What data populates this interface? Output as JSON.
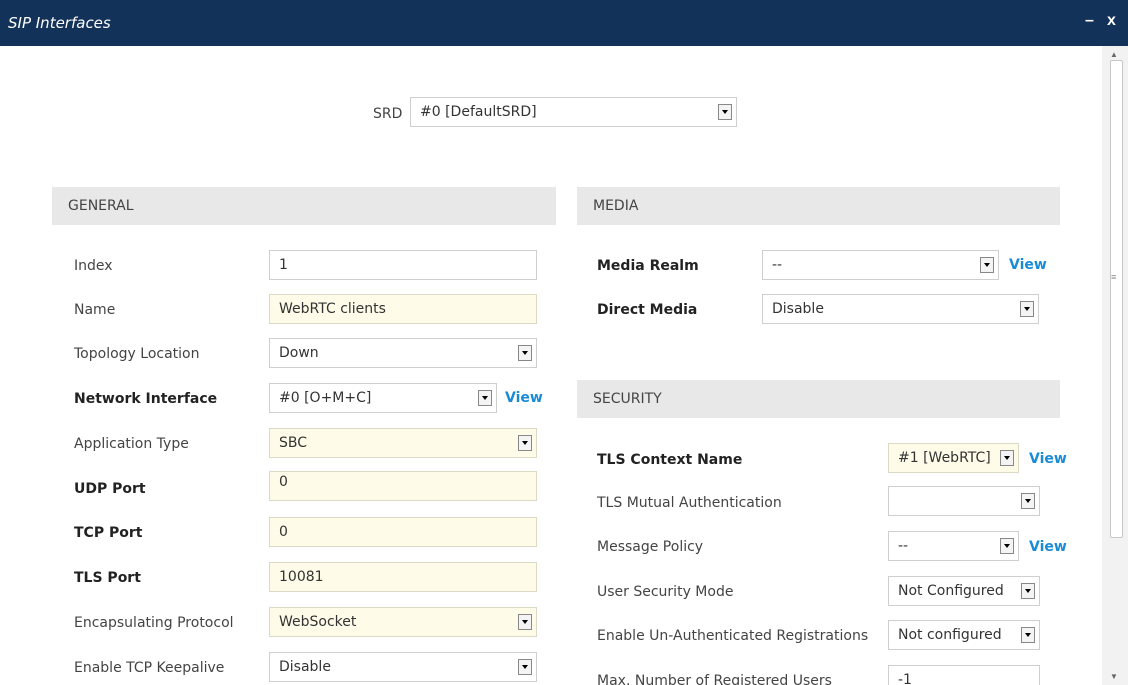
{
  "window": {
    "title": "SIP Interfaces",
    "minimize": "–",
    "close": "x"
  },
  "srd": {
    "label": "SRD",
    "value": "#0 [DefaultSRD]"
  },
  "general": {
    "heading": "GENERAL",
    "fields": {
      "index": {
        "label": "Index",
        "value": "1"
      },
      "name": {
        "label": "Name",
        "value": "WebRTC clients"
      },
      "topology": {
        "label": "Topology Location",
        "value": "Down"
      },
      "network_interface": {
        "label": "Network Interface",
        "value": "#0 [O+M+C]",
        "view": "View"
      },
      "application_type": {
        "label": "Application Type",
        "value": "SBC"
      },
      "udp_port": {
        "label": "UDP Port",
        "value": "0"
      },
      "tcp_port": {
        "label": "TCP Port",
        "value": "0"
      },
      "tls_port": {
        "label": "TLS Port",
        "value": "10081"
      },
      "encapsulating": {
        "label": "Encapsulating Protocol",
        "value": "WebSocket"
      },
      "tcp_keepalive": {
        "label": "Enable TCP Keepalive",
        "value": "Disable"
      }
    }
  },
  "media": {
    "heading": "MEDIA",
    "fields": {
      "media_realm": {
        "label": "Media Realm",
        "value": "--",
        "view": "View"
      },
      "direct_media": {
        "label": "Direct Media",
        "value": "Disable"
      }
    }
  },
  "security": {
    "heading": "SECURITY",
    "fields": {
      "tls_context": {
        "label": "TLS Context Name",
        "value": "#1 [WebRTC]",
        "view": "View"
      },
      "tls_mutual": {
        "label": "TLS Mutual Authentication",
        "value": ""
      },
      "message_policy": {
        "label": "Message Policy",
        "value": "--",
        "view": "View"
      },
      "user_security": {
        "label": "User Security Mode",
        "value": "Not Configured"
      },
      "unauth_reg": {
        "label": "Enable Un-Authenticated Registrations",
        "value": "Not configured"
      },
      "max_users": {
        "label": "Max. Number of Registered Users",
        "value": "-1"
      }
    }
  }
}
